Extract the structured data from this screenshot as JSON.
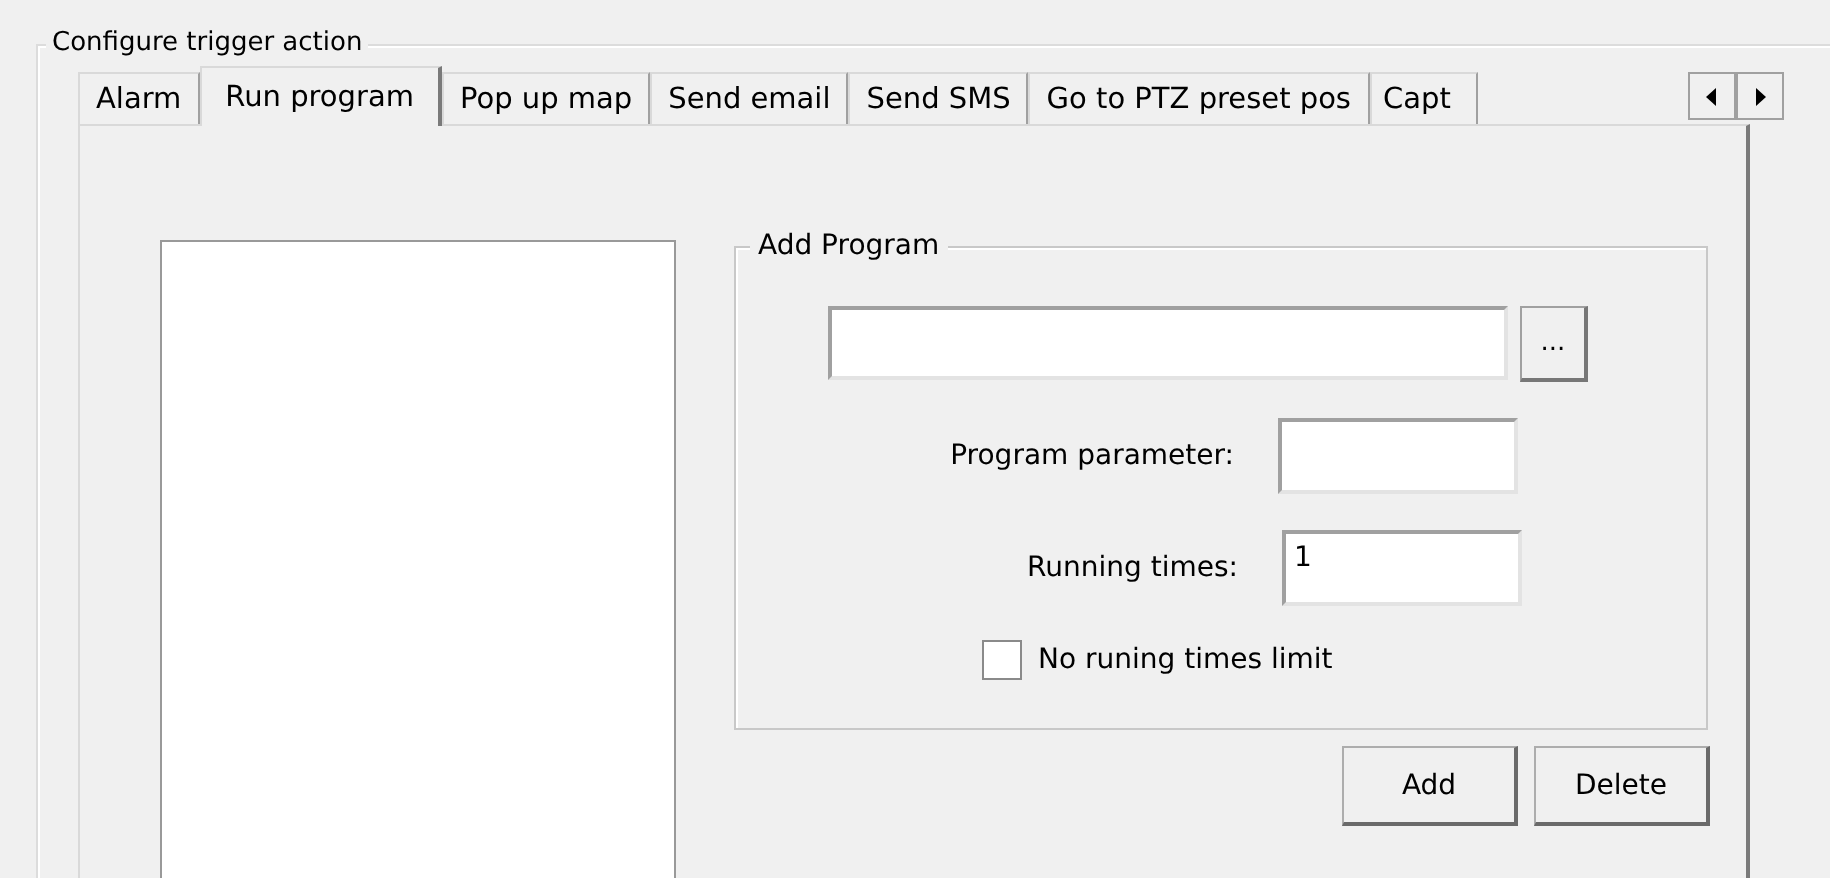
{
  "group": {
    "title": "Configure trigger action"
  },
  "tabs": [
    {
      "label": "Alarm",
      "selected": false
    },
    {
      "label": "Run program",
      "selected": true
    },
    {
      "label": "Pop up map",
      "selected": false
    },
    {
      "label": "Send email",
      "selected": false
    },
    {
      "label": "Send SMS",
      "selected": false
    },
    {
      "label": "Go to PTZ preset pos",
      "selected": false
    },
    {
      "label": "Capt",
      "selected": false
    }
  ],
  "add_program": {
    "title": "Add Program",
    "browse_button": "...",
    "fields": [
      {
        "label": "Program parameter:"
      },
      {
        "label": "Running times:",
        "value": "1"
      }
    ],
    "checkbox": {
      "label": "No runing times limit",
      "checked": false
    }
  },
  "buttons": [
    "Add",
    "Delete"
  ]
}
